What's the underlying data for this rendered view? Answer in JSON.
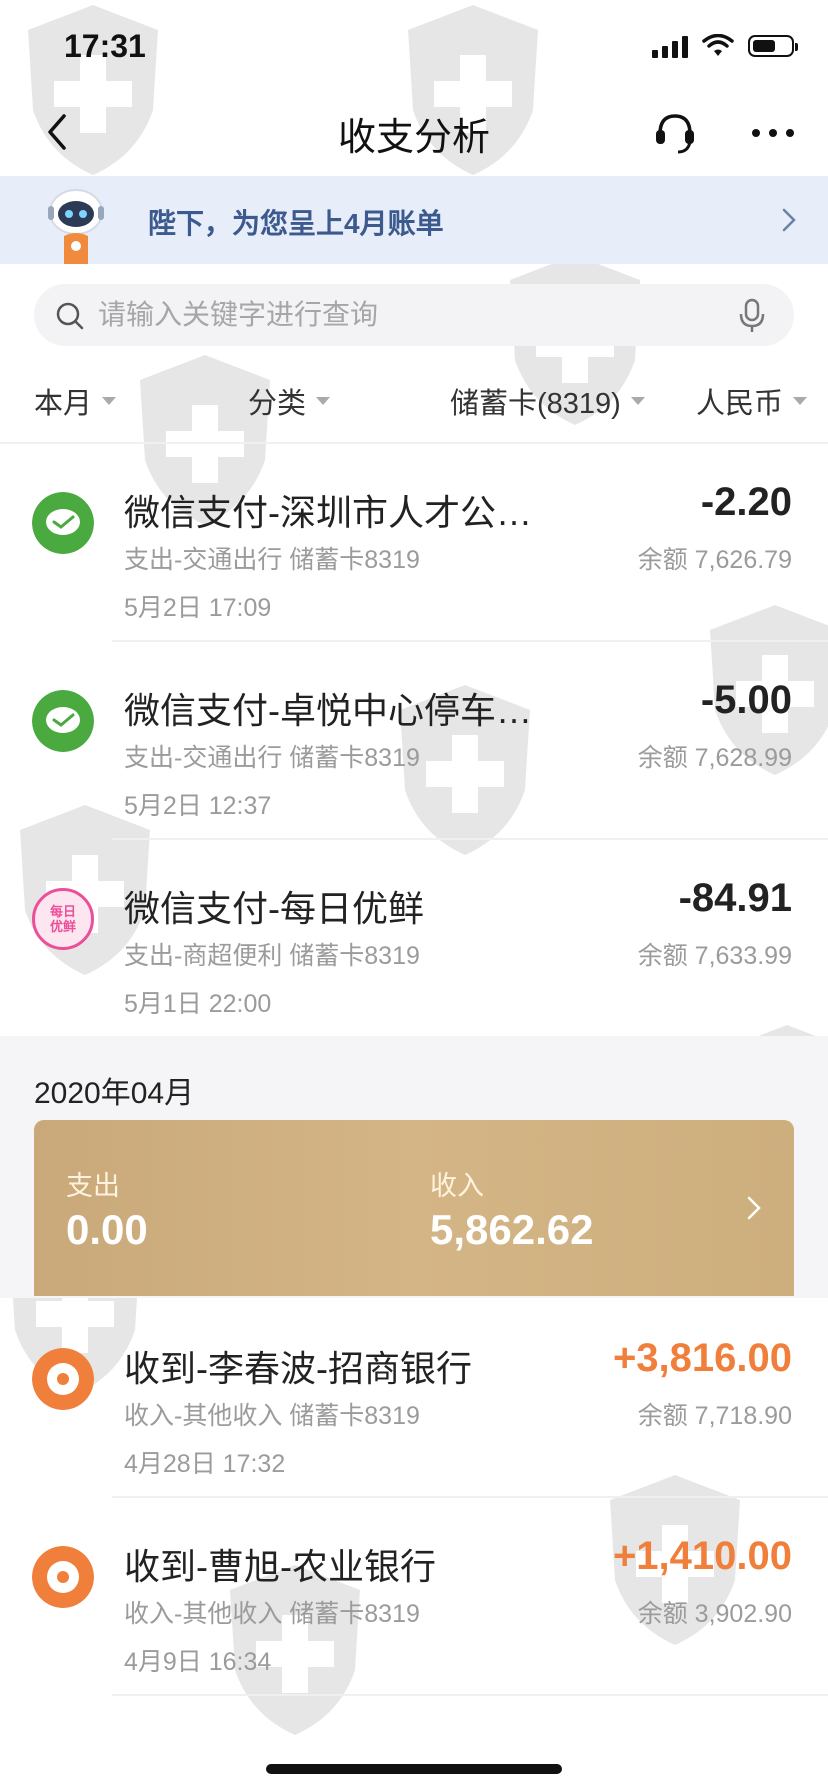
{
  "status_bar": {
    "time": "17:31"
  },
  "nav": {
    "title": "收支分析"
  },
  "banner": {
    "text": "陛下，为您呈上4月账单"
  },
  "search": {
    "placeholder": "请输入关键字进行查询"
  },
  "filters": [
    {
      "label": "本月"
    },
    {
      "label": "分类"
    },
    {
      "label": "储蓄卡(8319)"
    },
    {
      "label": "人民币"
    }
  ],
  "transactions_may": [
    {
      "title": "微信支付-深圳市人才公…",
      "subtitle": "支出-交通出行 储蓄卡8319",
      "time": "5月2日 17:09",
      "amount": "-2.20",
      "balance": "余额 7,626.79",
      "icon": "wechat-pay-icon",
      "icon_color": "#4aa93f"
    },
    {
      "title": "微信支付-卓悦中心停车…",
      "subtitle": "支出-交通出行 储蓄卡8319",
      "time": "5月2日 12:37",
      "amount": "-5.00",
      "balance": "余额 7,628.99",
      "icon": "wechat-pay-icon",
      "icon_color": "#4aa93f"
    },
    {
      "title": "微信支付-每日优鲜",
      "subtitle": "支出-商超便利 储蓄卡8319",
      "time": "5月1日 22:00",
      "amount": "-84.91",
      "balance": "余额 7,633.99",
      "icon": "missfresh-logo-icon",
      "icon_color": "#ec4f9a",
      "icon_text": "每日优鲜"
    }
  ],
  "month_section": {
    "label": "2020年04月",
    "expense_label": "支出",
    "expense_value": "0.00",
    "income_label": "收入",
    "income_value": "5,862.62"
  },
  "transactions_april": [
    {
      "title": "收到-李春波-招商银行",
      "subtitle": "收入-其他收入 储蓄卡8319",
      "time": "4月28日 17:32",
      "amount": "+3,816.00",
      "balance": "余额 7,718.90",
      "icon": "income-icon",
      "icon_color": "#ef7f3a"
    },
    {
      "title": "收到-曹旭-农业银行",
      "subtitle": "收入-其他收入 储蓄卡8319",
      "time": "4月9日 16:34",
      "amount": "+1,410.00",
      "balance": "余额 3,902.90",
      "icon": "income-icon",
      "icon_color": "#ef7f3a"
    }
  ],
  "colors": {
    "banner_bg": "#e7edf9",
    "banner_text": "#3c5a8e",
    "income_amount": "#ef7f3a",
    "wechat_green": "#4aa93f",
    "card_gold": "#cfae7e"
  }
}
